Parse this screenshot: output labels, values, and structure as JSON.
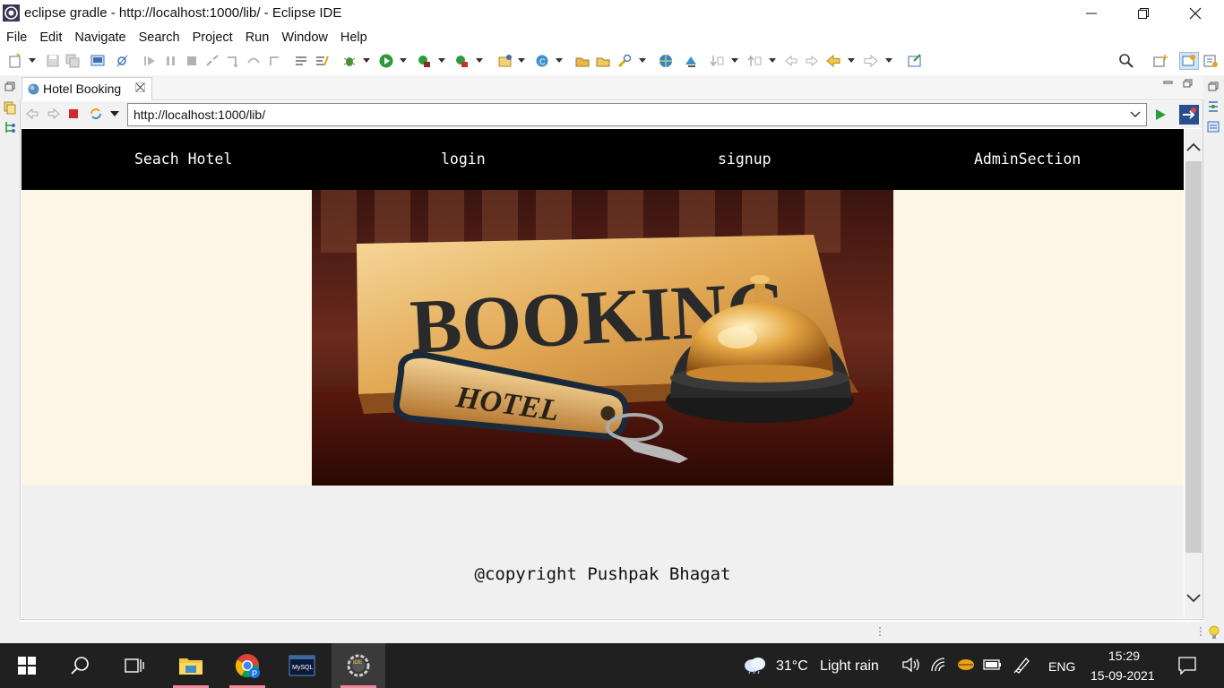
{
  "window": {
    "title": "eclipse gradle - http://localhost:1000/lib/ - Eclipse IDE"
  },
  "menu": [
    "File",
    "Edit",
    "Navigate",
    "Search",
    "Project",
    "Run",
    "Window",
    "Help"
  ],
  "editor": {
    "tab_label": "Hotel Booking",
    "url": "http://localhost:1000/lib/"
  },
  "page": {
    "nav": {
      "search_hotel": "Seach Hotel",
      "login": "login",
      "signup": "signup",
      "admin": "AdminSection"
    },
    "hero_image": {
      "sign_text": "BOOKING",
      "keytag_text": "HOTEL"
    },
    "footer": "@copyright Pushpak Bhagat"
  },
  "taskbar": {
    "apps": [
      "start",
      "search",
      "task-view",
      "file-explorer",
      "chrome",
      "mysql",
      "eclipse"
    ],
    "mysql_label": "MySQL",
    "weather": {
      "temp": "31°C",
      "condition": "Light rain"
    },
    "language": "ENG",
    "time": "15:29",
    "date": "15-09-2021"
  },
  "colors": {
    "navbar": "#000000",
    "hero_bg": "#fdf6e6",
    "page_bg": "#f0f0f0",
    "taskbar": "#202020",
    "indicator": "#f08a9a"
  }
}
